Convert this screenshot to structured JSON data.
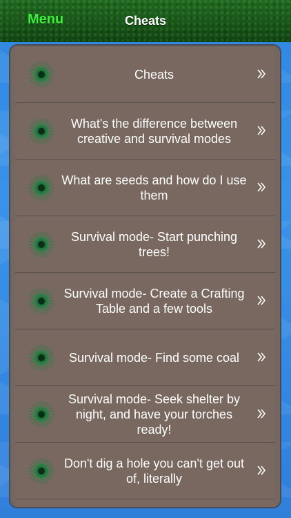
{
  "nav": {
    "menu_label": "Menu",
    "title": "Cheats"
  },
  "list": {
    "items": [
      {
        "label": "Cheats"
      },
      {
        "label": "What's the difference between creative and survival modes"
      },
      {
        "label": "What are seeds and how do I use them"
      },
      {
        "label": "Survival mode- Start punching trees!"
      },
      {
        "label": "Survival mode- Create a Crafting Table and a few tools"
      },
      {
        "label": "Survival mode- Find some coal"
      },
      {
        "label": "Survival mode- Seek shelter by night, and have your torches ready!"
      },
      {
        "label": "Don't dig a hole you can't get out of, literally"
      }
    ]
  },
  "icons": {
    "row_icon": "green-spiky-emblem-icon",
    "row_chevron": "double-chevron-right-icon"
  },
  "colors": {
    "nav_bg": "#175617",
    "menu_text": "#3cf03c",
    "row_bg": "#78685f",
    "page_bg": "#2f86e0"
  }
}
